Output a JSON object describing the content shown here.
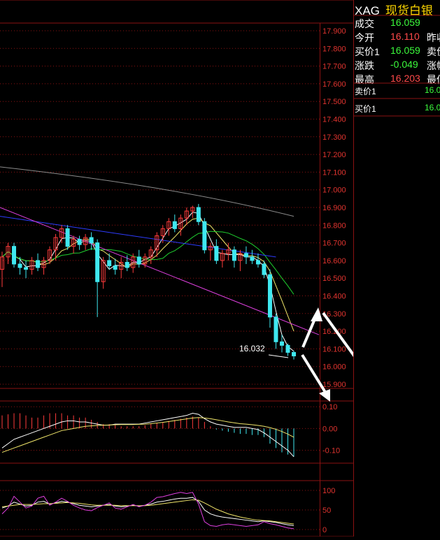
{
  "quote_panel": {
    "symbol": "XAG",
    "name": "现货白银",
    "rows": [
      {
        "label": "成交",
        "value": "16.059",
        "color": "green",
        "label2": ""
      },
      {
        "label": "今开",
        "value": "16.110",
        "color": "red",
        "label2": "昨收"
      },
      {
        "label": "买价1",
        "value": "16.059",
        "color": "green",
        "label2": "卖价"
      },
      {
        "label": "涨跌",
        "value": "-0.049",
        "color": "green",
        "label2": "涨幅"
      },
      {
        "label": "最高",
        "value": "16.203",
        "color": "red",
        "label2": "最低"
      }
    ],
    "ask": {
      "label": "卖价1",
      "value": "16.0"
    },
    "bid": {
      "label": "买价1",
      "value": "16.0"
    }
  },
  "colors": {
    "background": "#000000",
    "grid": "#8a1212",
    "axis_text": "#e0342f",
    "candle_up": "#ff3b3b",
    "candle_down": "#3fe8f0",
    "white_line": "#ffffff",
    "yellow_line": "#f1e66a",
    "magenta_line": "#e040e0",
    "blue_line": "#2e3cff",
    "green_line": "#1fd02f",
    "gray_line": "#8c8c8c",
    "arrow": "#ffffff"
  },
  "chart_data": [
    {
      "type": "candlestick",
      "name": "price",
      "ylim": [
        15.9,
        17.9
      ],
      "yticks": [
        "17.900",
        "17.800",
        "17.700",
        "17.600",
        "17.500",
        "17.400",
        "17.300",
        "17.200",
        "17.100",
        "17.000",
        "16.900",
        "16.800",
        "16.700",
        "16.600",
        "16.500",
        "16.400",
        "16.300",
        "16.200",
        "16.100",
        "16.000",
        "15.900"
      ],
      "annotation": "16.032",
      "annotation_value": 16.032,
      "candles": [
        [
          16.55,
          16.65,
          16.45,
          16.62
        ],
        [
          16.62,
          16.7,
          16.58,
          16.68
        ],
        [
          16.68,
          16.7,
          16.56,
          16.58
        ],
        [
          16.58,
          16.62,
          16.52,
          16.56
        ],
        [
          16.56,
          16.6,
          16.5,
          16.55
        ],
        [
          16.55,
          16.62,
          16.52,
          16.6
        ],
        [
          16.6,
          16.64,
          16.54,
          16.56
        ],
        [
          16.56,
          16.62,
          16.52,
          16.6
        ],
        [
          16.6,
          16.68,
          16.58,
          16.66
        ],
        [
          16.66,
          16.75,
          16.6,
          16.73
        ],
        [
          16.73,
          16.8,
          16.7,
          16.78
        ],
        [
          16.78,
          16.8,
          16.66,
          16.68
        ],
        [
          16.68,
          16.74,
          16.64,
          16.72
        ],
        [
          16.72,
          16.74,
          16.66,
          16.69
        ],
        [
          16.69,
          16.75,
          16.66,
          16.73
        ],
        [
          16.73,
          16.76,
          16.66,
          16.7
        ],
        [
          16.7,
          16.72,
          16.28,
          16.48
        ],
        [
          16.48,
          16.62,
          16.44,
          16.6
        ],
        [
          16.6,
          16.64,
          16.55,
          16.57
        ],
        [
          16.57,
          16.61,
          16.52,
          16.55
        ],
        [
          16.55,
          16.62,
          16.5,
          16.59
        ],
        [
          16.59,
          16.63,
          16.54,
          16.56
        ],
        [
          16.56,
          16.64,
          16.53,
          16.62
        ],
        [
          16.62,
          16.66,
          16.56,
          16.58
        ],
        [
          16.58,
          16.64,
          16.56,
          16.62
        ],
        [
          16.62,
          16.68,
          16.58,
          16.66
        ],
        [
          16.66,
          16.76,
          16.62,
          16.74
        ],
        [
          16.74,
          16.8,
          16.7,
          16.78
        ],
        [
          16.78,
          16.84,
          16.74,
          16.82
        ],
        [
          16.82,
          16.86,
          16.76,
          16.78
        ],
        [
          16.78,
          16.86,
          16.74,
          16.84
        ],
        [
          16.84,
          16.9,
          16.8,
          16.88
        ],
        [
          16.88,
          16.91,
          16.84,
          16.9
        ],
        [
          16.9,
          16.92,
          16.8,
          16.82
        ],
        [
          16.82,
          16.84,
          16.64,
          16.66
        ],
        [
          16.66,
          16.7,
          16.6,
          16.68
        ],
        [
          16.68,
          16.72,
          16.58,
          16.6
        ],
        [
          16.6,
          16.66,
          16.56,
          16.64
        ],
        [
          16.64,
          16.7,
          16.6,
          16.66
        ],
        [
          16.66,
          16.68,
          16.56,
          16.6
        ],
        [
          16.6,
          16.66,
          16.54,
          16.64
        ],
        [
          16.64,
          16.68,
          16.58,
          16.62
        ],
        [
          16.62,
          16.66,
          16.58,
          16.6
        ],
        [
          16.6,
          16.64,
          16.56,
          16.58
        ],
        [
          16.58,
          16.6,
          16.5,
          16.52
        ],
        [
          16.52,
          16.55,
          16.22,
          16.28
        ],
        [
          16.28,
          16.3,
          16.1,
          16.14
        ],
        [
          16.14,
          16.18,
          16.08,
          16.12
        ],
        [
          16.12,
          16.13,
          16.06,
          16.08
        ],
        [
          16.08,
          16.09,
          16.04,
          16.06
        ]
      ]
    },
    {
      "type": "line",
      "name": "macd",
      "ylim": [
        -0.15,
        0.12
      ],
      "yticks": [
        "0.10",
        "0.00",
        "-0.10"
      ],
      "hist": [
        0.06,
        0.065,
        0.07,
        0.07,
        0.06,
        0.05,
        0.05,
        0.06,
        0.07,
        0.07,
        0.07,
        0.06,
        0.06,
        0.05,
        0.05,
        0.04,
        0.03,
        0.02,
        0.02,
        0.015,
        0.01,
        0.01,
        0.01,
        0.01,
        0.015,
        0.02,
        0.025,
        0.03,
        0.035,
        0.04,
        0.045,
        0.05,
        0.055,
        0.05,
        0.03,
        0.01,
        -0.005,
        -0.01,
        -0.015,
        -0.02,
        -0.025,
        -0.025,
        -0.03,
        -0.03,
        -0.04,
        -0.07,
        -0.09,
        -0.11,
        -0.12,
        -0.13
      ],
      "dif": [
        -0.09,
        -0.07,
        -0.05,
        -0.04,
        -0.03,
        -0.02,
        -0.01,
        0.0,
        0.01,
        0.02,
        0.03,
        0.035,
        0.035,
        0.03,
        0.03,
        0.025,
        0.02,
        0.015,
        0.015,
        0.02,
        0.02,
        0.02,
        0.02,
        0.02,
        0.025,
        0.03,
        0.035,
        0.04,
        0.045,
        0.05,
        0.055,
        0.06,
        0.07,
        0.065,
        0.045,
        0.03,
        0.02,
        0.015,
        0.01,
        0.005,
        0.005,
        0.005,
        0.0,
        -0.005,
        -0.02,
        -0.04,
        -0.06,
        -0.08,
        -0.1,
        -0.13
      ],
      "dea": [
        -0.11,
        -0.1,
        -0.09,
        -0.08,
        -0.07,
        -0.06,
        -0.05,
        -0.04,
        -0.03,
        -0.02,
        -0.01,
        -0.005,
        0.0,
        0.005,
        0.01,
        0.012,
        0.014,
        0.015,
        0.016,
        0.017,
        0.018,
        0.018,
        0.018,
        0.019,
        0.02,
        0.022,
        0.025,
        0.028,
        0.032,
        0.036,
        0.04,
        0.044,
        0.048,
        0.05,
        0.048,
        0.045,
        0.04,
        0.035,
        0.03,
        0.026,
        0.022,
        0.02,
        0.017,
        0.014,
        0.01,
        0.004,
        -0.004,
        -0.014,
        -0.026,
        -0.04
      ]
    },
    {
      "type": "line",
      "name": "kdj",
      "ylim": [
        0,
        100
      ],
      "yticks": [
        "100",
        "50",
        "0"
      ],
      "k": [
        55,
        60,
        70,
        65,
        60,
        62,
        70,
        72,
        65,
        68,
        72,
        70,
        66,
        62,
        60,
        58,
        60,
        62,
        64,
        60,
        58,
        60,
        62,
        60,
        62,
        65,
        70,
        72,
        75,
        78,
        80,
        80,
        82,
        72,
        50,
        40,
        35,
        32,
        30,
        28,
        26,
        24,
        22,
        20,
        22,
        20,
        18,
        15,
        12,
        10
      ],
      "d": [
        58,
        60,
        62,
        64,
        64,
        64,
        65,
        66,
        66,
        67,
        68,
        69,
        68,
        67,
        65,
        63,
        62,
        62,
        62,
        62,
        61,
        61,
        61,
        61,
        61,
        62,
        64,
        66,
        68,
        70,
        72,
        74,
        76,
        75,
        68,
        60,
        52,
        46,
        40,
        36,
        32,
        29,
        26,
        24,
        23,
        22,
        20,
        18,
        16,
        14
      ],
      "j": [
        40,
        55,
        85,
        70,
        55,
        60,
        80,
        85,
        62,
        70,
        80,
        72,
        62,
        55,
        50,
        48,
        56,
        62,
        68,
        55,
        52,
        58,
        64,
        58,
        62,
        70,
        82,
        84,
        88,
        92,
        95,
        92,
        95,
        65,
        20,
        10,
        8,
        12,
        14,
        12,
        10,
        8,
        10,
        12,
        20,
        15,
        12,
        8,
        4,
        2
      ]
    }
  ]
}
